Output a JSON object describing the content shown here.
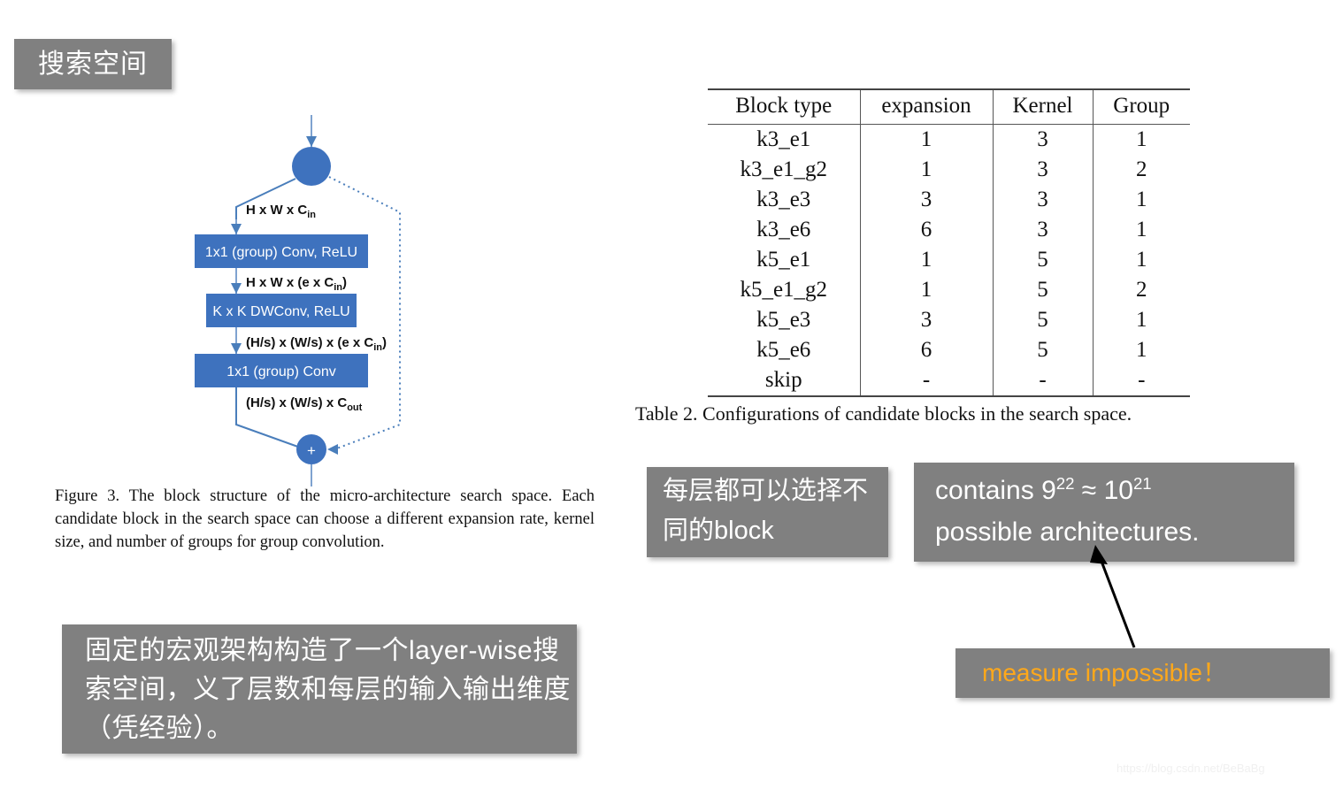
{
  "slide": {
    "title_badge": "搜索空间",
    "watermark": "https://blog.csdn.net/BeBaBg"
  },
  "figure": {
    "input_label": "H x W x C",
    "input_sub": "in",
    "blocks": [
      {
        "label": "1x1 (group) Conv, ReLU"
      },
      {
        "label": "K x K DWConv, ReLU"
      },
      {
        "label": "1x1 (group) Conv"
      }
    ],
    "edge_labels": [
      {
        "main": "H x W x C",
        "sub": "in",
        "tail": ""
      },
      {
        "main": "H x W x (e x C",
        "sub": "in",
        "tail": ")"
      },
      {
        "main": "(H/s) x (W/s) x (e x C",
        "sub": "in",
        "tail": ")"
      },
      {
        "main": "(H/s) x (W/s) x C",
        "sub": "out",
        "tail": ""
      }
    ],
    "merge_symbol": "+",
    "caption": "Figure 3. The block structure of the micro-architecture search space. Each candidate block in the search space can choose a different expansion rate, kernel size, and number of groups for group convolution.",
    "node_color": "#3E72BE",
    "box_color": "#3E72BE"
  },
  "table": {
    "columns": [
      "Block type",
      "expansion",
      "Kernel",
      "Group"
    ],
    "rows": [
      [
        "k3_e1",
        "1",
        "3",
        "1"
      ],
      [
        "k3_e1_g2",
        "1",
        "3",
        "2"
      ],
      [
        "k3_e3",
        "3",
        "3",
        "1"
      ],
      [
        "k3_e6",
        "6",
        "3",
        "1"
      ],
      [
        "k5_e1",
        "1",
        "5",
        "1"
      ],
      [
        "k5_e1_g2",
        "1",
        "5",
        "2"
      ],
      [
        "k5_e3",
        "3",
        "5",
        "1"
      ],
      [
        "k5_e6",
        "6",
        "5",
        "1"
      ],
      [
        "skip",
        "-",
        "-",
        "-"
      ]
    ],
    "caption": "Table 2. Configurations of candidate blocks in the search space."
  },
  "annotations": {
    "macro_note": "固定的宏观架构构造了一个layer-wise搜索空间，义了层数和每层的输入输出维度（凭经验）。",
    "layer_note": "每层都可以选择不同的block",
    "contains_prefix": "contains 9",
    "contains_exp1": "22",
    "contains_mid": " ≈ 10",
    "contains_exp2": "21",
    "contains_line2": "possible architectures.",
    "measure_note": "measure impossible！",
    "measure_color": "#FFA81A",
    "box_color": "#808080"
  }
}
